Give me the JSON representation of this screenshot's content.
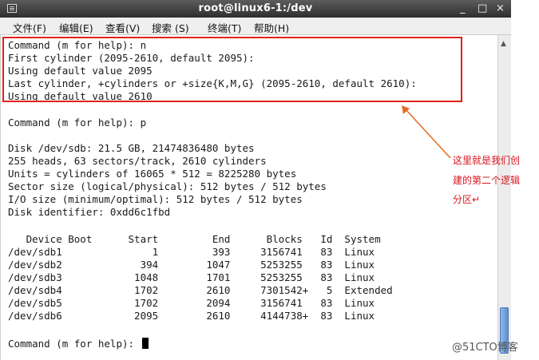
{
  "window": {
    "title": "root@linux6-1:/dev",
    "minimize_glyph": "_",
    "maximize_glyph": "□",
    "close_glyph": "×"
  },
  "menu": [
    "文件(F)",
    "编辑(E)",
    "查看(V)",
    "搜索 (S)",
    "终端(T)",
    "帮助(H)"
  ],
  "terminal_lines": [
    "Command (m for help): n",
    "First cylinder (2095-2610, default 2095):",
    "Using default value 2095",
    "Last cylinder, +cylinders or +size{K,M,G} (2095-2610, default 2610):",
    "Using default value 2610",
    "",
    "Command (m for help): p",
    "",
    "Disk /dev/sdb: 21.5 GB, 21474836480 bytes",
    "255 heads, 63 sectors/track, 2610 cylinders",
    "Units = cylinders of 16065 * 512 = 8225280 bytes",
    "Sector size (logical/physical): 512 bytes / 512 bytes",
    "I/O size (minimum/optimal): 512 bytes / 512 bytes",
    "Disk identifier: 0xdd6c1fbd",
    "",
    "   Device Boot      Start         End      Blocks   Id  System",
    "/dev/sdb1               1         393     3156741   83  Linux",
    "/dev/sdb2             394        1047     5253255   83  Linux",
    "/dev/sdb3            1048        1701     5253255   83  Linux",
    "/dev/sdb4            1702        2610     7301542+   5  Extended",
    "/dev/sdb5            1702        2094     3156741   83  Linux",
    "/dev/sdb6            2095        2610     4144738+  83  Linux",
    "",
    "Command (m for help): "
  ],
  "annotation": {
    "note_lines": [
      "这里就是我们创",
      "建的第二个逻辑",
      "分区↵"
    ],
    "color": "#e0201a"
  },
  "watermark": "@51CTO博客"
}
